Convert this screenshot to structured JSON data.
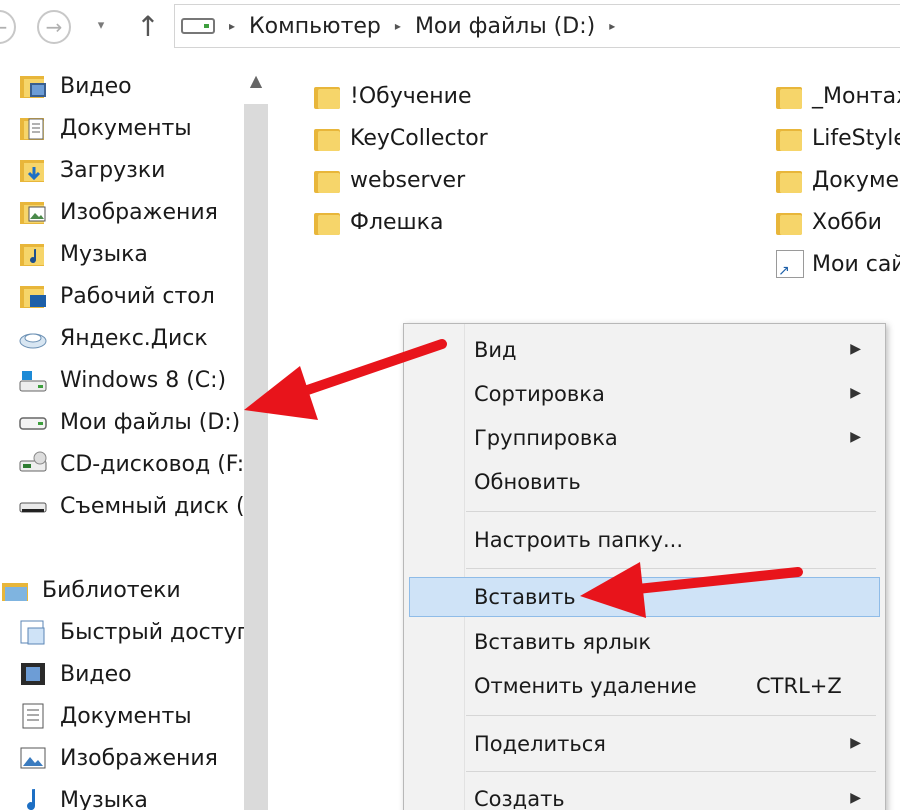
{
  "nav": {
    "back_glyph": "←",
    "forward_glyph": "→",
    "dropdown_glyph": "▾",
    "up_glyph": "↑"
  },
  "address_bar": {
    "breadcrumbs": [
      "Компьютер",
      "Мои файлы (D:)"
    ],
    "separator": "▸"
  },
  "sidebar": {
    "scroll_up_glyph": "▲",
    "items": [
      {
        "label": "Видео",
        "icon": "video-folder-icon"
      },
      {
        "label": "Документы",
        "icon": "documents-folder-icon"
      },
      {
        "label": "Загрузки",
        "icon": "downloads-folder-icon"
      },
      {
        "label": "Изображения",
        "icon": "pictures-folder-icon"
      },
      {
        "label": "Музыка",
        "icon": "music-folder-icon"
      },
      {
        "label": "Рабочий стол",
        "icon": "desktop-folder-icon"
      },
      {
        "label": "Яндекс.Диск",
        "icon": "yandex-disk-icon"
      },
      {
        "label": "Windows 8 (C:)",
        "icon": "windows-drive-icon"
      },
      {
        "label": "Мои файлы (D:)",
        "icon": "hard-drive-icon"
      },
      {
        "label": "CD-дисковод (F:",
        "icon": "cd-drive-icon"
      },
      {
        "label": "Съемный диск (.",
        "icon": "removable-drive-icon"
      },
      {
        "label": "Библиотеки",
        "icon": "libraries-icon"
      },
      {
        "label": "Быстрый доступ",
        "icon": "quick-access-icon"
      },
      {
        "label": "Видео",
        "icon": "video-library-icon"
      },
      {
        "label": "Документы",
        "icon": "documents-library-icon"
      },
      {
        "label": "Изображения",
        "icon": "pictures-library-icon"
      },
      {
        "label": "Музыка",
        "icon": "music-library-icon"
      }
    ]
  },
  "files": {
    "column1": [
      "!Обучение",
      "KeyCollector",
      "webserver",
      "Флешка"
    ],
    "column2": [
      "_Монтаж",
      "LifeStyle",
      "Докумен",
      "Хобби",
      "Мои сай"
    ]
  },
  "context_menu": {
    "items": [
      {
        "label": "Вид",
        "submenu": true
      },
      {
        "label": "Сортировка",
        "submenu": true
      },
      {
        "label": "Группировка",
        "submenu": true
      },
      {
        "label": "Обновить",
        "submenu": false
      },
      {
        "label": "Настроить папку...",
        "submenu": false
      },
      {
        "label": "Вставить",
        "submenu": false,
        "highlighted": true
      },
      {
        "label": "Вставить ярлык",
        "submenu": false
      },
      {
        "label": "Отменить удаление",
        "submenu": false,
        "shortcut": "CTRL+Z"
      },
      {
        "label": "Поделиться",
        "submenu": true
      },
      {
        "label": "Создать",
        "submenu": true
      }
    ],
    "submenu_glyph": "▶"
  },
  "colors": {
    "annotation_arrow": "#e8141b",
    "highlight_bg": "#cfe3f7",
    "highlight_border": "#8fbce8",
    "folder": "#f6d56a"
  }
}
